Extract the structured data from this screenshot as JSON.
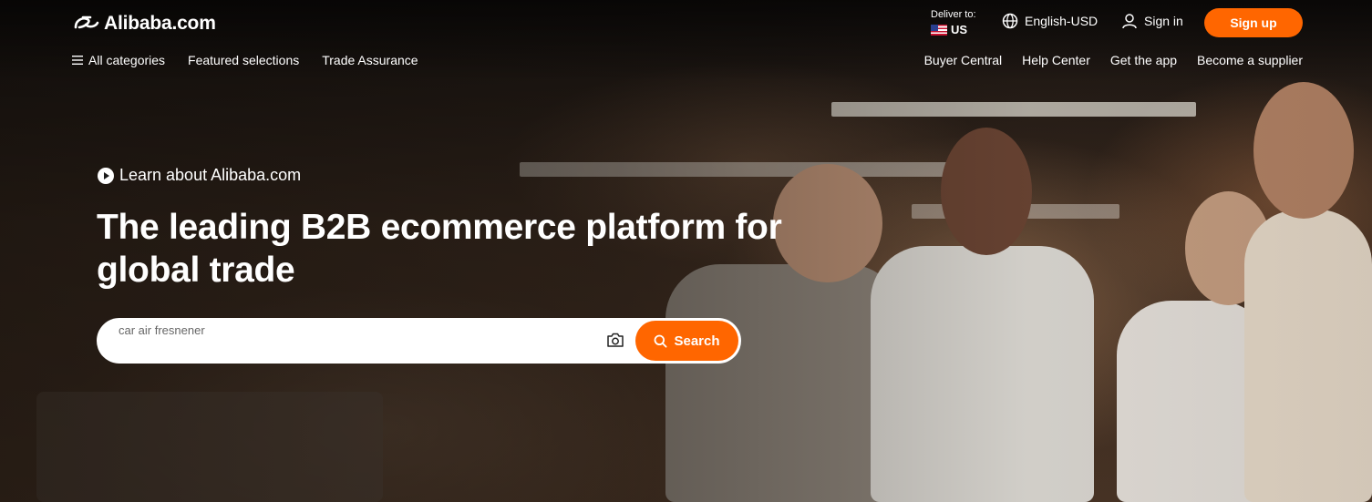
{
  "header": {
    "logo_text": "Alibaba.com",
    "deliver_label": "Deliver to:",
    "deliver_country": "US",
    "language_currency": "English-USD",
    "signin_label": "Sign in",
    "signup_label": "Sign up"
  },
  "nav": {
    "left": [
      "All categories",
      "Featured selections",
      "Trade Assurance"
    ],
    "right": [
      "Buyer Central",
      "Help Center",
      "Get the app",
      "Become a supplier"
    ]
  },
  "hero": {
    "learn_label": "Learn about Alibaba.com",
    "headline": "The leading B2B ecommerce platform for global trade"
  },
  "search": {
    "placeholder": "car air fresnener",
    "button_label": "Search"
  },
  "colors": {
    "accent": "#ff6600",
    "text_on_hero": "#ffffff"
  },
  "icons": [
    "alibaba-logo-icon",
    "us-flag-icon",
    "globe-icon",
    "user-icon",
    "menu-icon",
    "play-icon",
    "camera-icon",
    "search-icon"
  ]
}
